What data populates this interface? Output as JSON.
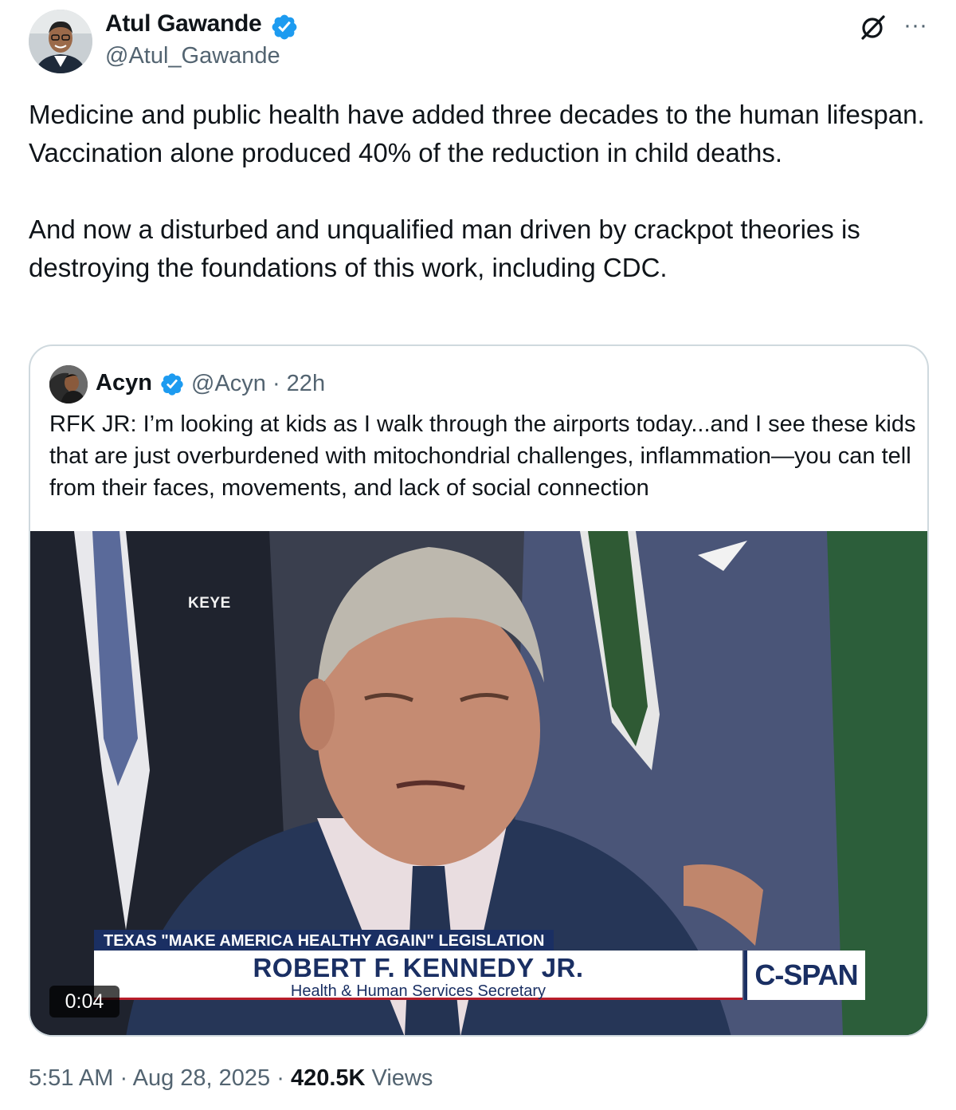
{
  "author": {
    "name": "Atul Gawande",
    "handle": "@Atul_Gawande",
    "verified": true
  },
  "header_icons": {
    "grok": "grok-icon",
    "more": "more-icon",
    "more_glyph": "···"
  },
  "tweet": {
    "paragraph_1": "Medicine and public health have added three decades to the human lifespan. Vaccination alone produced 40% of the reduction in child deaths.",
    "paragraph_2": "And now a disturbed and unqualified man driven by crackpot theories is destroying the foundations of this work, including CDC."
  },
  "quote": {
    "name": "Acyn",
    "handle_time": "@Acyn · 22h",
    "text": "RFK JR: I’m looking at kids as I walk through the airports today...and I see these kids that are just overburdened with mitochondrial challenges, inflammation—you can tell from their faces, movements, and lack of social connection",
    "video": {
      "watermark": "KEYE",
      "banner": "TEXAS \"MAKE AMERICA HEALTHY AGAIN\" LEGISLATION",
      "name": "ROBERT F. KENNEDY JR.",
      "title": "Health & Human Services Secretary",
      "network": "C-SPAN",
      "duration": "0:04"
    }
  },
  "footer": {
    "time": "5:51 AM",
    "date": "Aug 28, 2025",
    "views_count": "420.5K",
    "views_label": "Views",
    "separator": "·"
  },
  "colors": {
    "verified": "#1d9bf0",
    "secondary_text": "#536471",
    "primary_text": "#0f1419",
    "border": "#cfd9de",
    "cspan_navy": "#1a2f63"
  }
}
